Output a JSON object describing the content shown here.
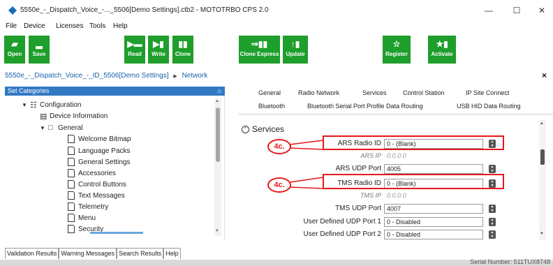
{
  "window": {
    "title": "5550e_-_Dispatch_Voice_-..._5506[Demo Settings].ctb2 - MOTOTRBO CPS 2.0",
    "min": "—",
    "max": "☐",
    "close": "✕"
  },
  "menu": [
    "File",
    "Device",
    "Licenses",
    "Tools",
    "Help"
  ],
  "toolbar": [
    {
      "label": "Open",
      "glyph": "▰"
    },
    {
      "label": "Save",
      "glyph": "▂"
    },
    {
      "label": "Read",
      "glyph": "▶▬"
    },
    {
      "label": "Write",
      "glyph": "▶▮"
    },
    {
      "label": "Clone",
      "glyph": "▮▮"
    },
    {
      "label": "Clone Express",
      "glyph": "⇒▮▮"
    },
    {
      "label": "Update",
      "glyph": "↑▮"
    },
    {
      "label": "Register",
      "glyph": "☆"
    },
    {
      "label": "Activate",
      "glyph": "★▮"
    }
  ],
  "breadcrumb": {
    "path": "5550e_-_Dispatch_Voice_-_ID_5506[Demo Settings]",
    "sep": "▶",
    "current": "Network",
    "close": "×"
  },
  "left_panel": {
    "header": "Set Categories",
    "pin": "⌂",
    "tree": [
      {
        "label": "Configuration",
        "expander": "▼",
        "icon": "☷"
      },
      {
        "label": "Device Information",
        "icon": "▤"
      },
      {
        "label": "General",
        "expander": "▼",
        "icon": "□"
      },
      {
        "label": "Welcome Bitmap"
      },
      {
        "label": "Language Packs"
      },
      {
        "label": "General Settings"
      },
      {
        "label": "Accessories"
      },
      {
        "label": "Control Buttons"
      },
      {
        "label": "Text Messages"
      },
      {
        "label": "Telemetry"
      },
      {
        "label": "Menu"
      },
      {
        "label": "Security"
      }
    ]
  },
  "tabs": {
    "row1": [
      "General",
      "Radio Network",
      "Services",
      "Control Station",
      "IP Site Connect"
    ],
    "row2": [
      "Bluetooth",
      "Bluetooth Serial Port Profile Data Routing",
      "USB HID Data Routing"
    ]
  },
  "section": {
    "title": "Services",
    "collapse_glyph": "⌃"
  },
  "fields": {
    "ars_radio_id": {
      "label": "ARS Radio ID",
      "value": "0 - (Blank)"
    },
    "ars_ip": {
      "label": "ARS IP",
      "value": "0.0.0.0"
    },
    "ars_udp_port": {
      "label": "ARS UDP Port",
      "value": "4005"
    },
    "tms_radio_id": {
      "label": "TMS Radio ID",
      "value": "0 - (Blank)"
    },
    "tms_ip": {
      "label": "TMS IP",
      "value": "0.0.0.0"
    },
    "tms_udp_port": {
      "label": "TMS UDP Port",
      "value": "4007"
    },
    "user_port_1": {
      "label": "User Defined UDP Port 1",
      "value": "0 - Disabled"
    },
    "user_port_2": {
      "label": "User Defined UDP Port 2",
      "value": "0 - Disabled"
    }
  },
  "callouts": [
    "4c.",
    "4c."
  ],
  "bottom_tabs": [
    "Validation Results",
    "Warning Messages",
    "Search Results",
    "Help"
  ],
  "status": {
    "serial": "Serial Number: 511TUX8748"
  },
  "colors": {
    "toolbar_green": "#1e9e2a",
    "header_blue": "#3279c4",
    "callout_red": "#e8161c"
  }
}
